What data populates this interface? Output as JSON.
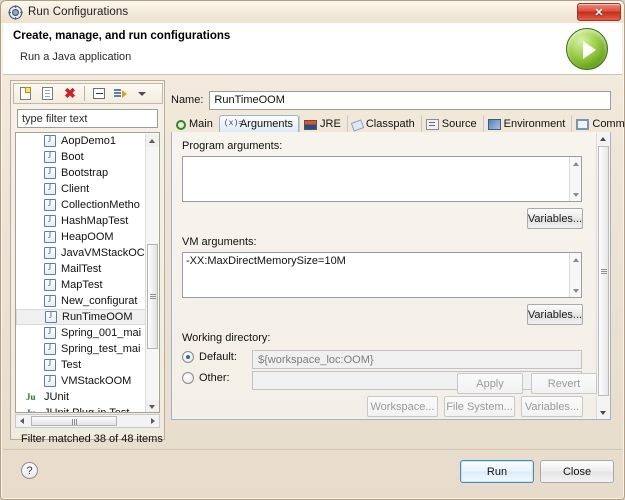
{
  "window": {
    "title": "Run Configurations",
    "icon": "run-configurations-icon",
    "close_label": "✕"
  },
  "header": {
    "title": "Create, manage, and run configurations",
    "subtitle": "Run a Java application",
    "badge_icon": "run-play-icon"
  },
  "left_panel": {
    "toolbar": [
      {
        "name": "new-configuration-icon",
        "tip": "New launch configuration"
      },
      {
        "name": "duplicate-configuration-icon",
        "tip": "Duplicate"
      },
      {
        "name": "delete-configuration-icon",
        "tip": "Delete"
      },
      {
        "name": "collapse-all-icon",
        "tip": "Collapse All"
      },
      {
        "name": "filter-icon",
        "tip": "Filter"
      },
      {
        "name": "chevron-down-icon",
        "tip": "Menu"
      }
    ],
    "filter_value": "type filter text",
    "filter_placeholder": "type filter text",
    "tree_items": [
      {
        "label": "AopDemo1",
        "type": "java",
        "selected": false
      },
      {
        "label": "Boot",
        "type": "java",
        "selected": false
      },
      {
        "label": "Bootstrap",
        "type": "java",
        "selected": false
      },
      {
        "label": "Client",
        "type": "java",
        "selected": false
      },
      {
        "label": "CollectionMetho",
        "type": "java",
        "selected": false
      },
      {
        "label": "HashMapTest",
        "type": "java",
        "selected": false
      },
      {
        "label": "HeapOOM",
        "type": "java",
        "selected": false
      },
      {
        "label": "JavaVMStackOC",
        "type": "java",
        "selected": false
      },
      {
        "label": "MailTest",
        "type": "java",
        "selected": false
      },
      {
        "label": "MapTest",
        "type": "java",
        "selected": false
      },
      {
        "label": "New_configurat",
        "type": "java",
        "selected": false
      },
      {
        "label": "RunTimeOOM",
        "type": "java",
        "selected": true
      },
      {
        "label": "Spring_001_mai",
        "type": "java",
        "selected": false
      },
      {
        "label": "Spring_test_mai",
        "type": "java",
        "selected": false
      },
      {
        "label": "Test",
        "type": "java",
        "selected": false
      },
      {
        "label": "VMStackOOM",
        "type": "java",
        "selected": false
      },
      {
        "label": "JUnit",
        "type": "junit",
        "selected": false
      },
      {
        "label": "JUnit Plug-in Test",
        "type": "junit-plugin",
        "selected": false
      }
    ],
    "filter_status": "Filter matched 38 of 48 items"
  },
  "right_panel": {
    "name_label": "Name:",
    "name_value": "RunTimeOOM",
    "tabs": [
      {
        "label": "Main",
        "icon": "main-tab-icon",
        "active": false
      },
      {
        "label": "Arguments",
        "icon": "arguments-tab-icon",
        "active": true
      },
      {
        "label": "JRE",
        "icon": "jre-tab-icon",
        "active": false
      },
      {
        "label": "Classpath",
        "icon": "classpath-tab-icon",
        "active": false
      },
      {
        "label": "Source",
        "icon": "source-tab-icon",
        "active": false
      },
      {
        "label": "Environment",
        "icon": "environment-tab-icon",
        "active": false
      },
      {
        "label": "Common",
        "icon": "common-tab-icon",
        "active": false
      }
    ],
    "program_arguments": {
      "label": "Program arguments:",
      "value": "",
      "variables_button": "Variables..."
    },
    "vm_arguments": {
      "label": "VM arguments:",
      "value": "-XX:MaxDirectMemorySize=10M",
      "variables_button": "Variables..."
    },
    "working_directory": {
      "label": "Working directory:",
      "default_radio_label": "Default:",
      "default_selected": true,
      "default_value": "${workspace_loc:OOM}",
      "other_radio_label": "Other:",
      "other_selected": false,
      "other_value": "",
      "workspace_button": "Workspace...",
      "file_system_button": "File System...",
      "variables_button": "Variables..."
    },
    "apply_button": "Apply",
    "revert_button": "Revert"
  },
  "footer": {
    "help_icon": "help-icon",
    "help_label": "?",
    "run_button": "Run",
    "close_button": "Close"
  }
}
